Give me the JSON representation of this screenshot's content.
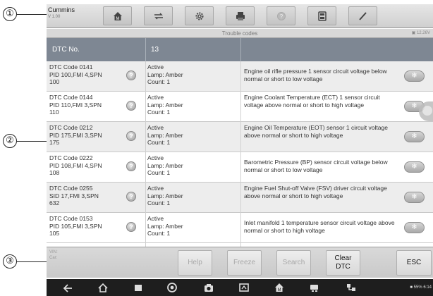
{
  "callouts": [
    "①",
    "②",
    "③"
  ],
  "brand": {
    "name": "Cummins",
    "version": "V 1.00"
  },
  "toolbar": {
    "icons": [
      "home-icon",
      "vehicle-swap-icon",
      "settings-gear-icon",
      "print-icon",
      "help-icon",
      "save-icon",
      "pen-icon"
    ]
  },
  "subbar": {
    "title": "Trouble codes",
    "battery": "12.26V"
  },
  "table": {
    "headers": [
      "DTC No.",
      "13",
      ""
    ],
    "rows": [
      {
        "dtc": [
          "DTC Code 0141",
          "PID 100,FMI 4,SPN",
          "100"
        ],
        "status": [
          "Active",
          "Lamp: Amber",
          "Count: 1"
        ],
        "desc": "Engine oil rifle pressure 1 sensor circuit voltage below normal or short to low voltage"
      },
      {
        "dtc": [
          "DTC Code 0144",
          "PID 110,FMI 3,SPN",
          "110"
        ],
        "status": [
          "Active",
          "Lamp: Amber",
          "Count: 1"
        ],
        "desc": "Engine Coolant Temperature (ECT) 1 sensor circuit voltage above normal or short to high voltage"
      },
      {
        "dtc": [
          "DTC Code 0212",
          "PID 175,FMI 3,SPN",
          "175"
        ],
        "status": [
          "Active",
          "Lamp: Amber",
          "Count: 1"
        ],
        "desc": "Engine Oil Temperature (EOT) sensor 1 circuit voltage above normal or short to high voltage"
      },
      {
        "dtc": [
          "DTC Code 0222",
          "PID 108,FMI 4,SPN",
          "108"
        ],
        "status": [
          "Active",
          "Lamp: Amber",
          "Count: 1"
        ],
        "desc": "Barometric Pressure (BP) sensor circuit voltage below normal or short to low voltage"
      },
      {
        "dtc": [
          "DTC Code 0255",
          "SID 17,FMI 3,SPN",
          "632"
        ],
        "status": [
          "Active",
          "Lamp: Amber",
          "Count: 1"
        ],
        "desc": "Engine Fuel Shut-off Valve (FSV) driver circuit voltage above normal or short to high voltage"
      },
      {
        "dtc": [
          "DTC Code 0153",
          "PID 105,FMI 3,SPN",
          "105"
        ],
        "status": [
          "Active",
          "Lamp: Amber",
          "Count: 1"
        ],
        "desc": "Inlet manifold 1 temperature sensor circuit voltage above normal or short to high voltage"
      }
    ]
  },
  "actionbar": {
    "vin_label": "VIN:",
    "car_label": "Car:",
    "buttons": {
      "help": "Help",
      "freeze": "Freeze",
      "search": "Search",
      "clear": "Clear DTC",
      "esc": "ESC"
    }
  },
  "navbar": {
    "icons": [
      "back-icon",
      "home-nav-icon",
      "recent-apps-icon",
      "browser-icon",
      "camera-icon",
      "screen-cast-icon",
      "autel-home-icon",
      "vci-icon",
      "network-icon"
    ],
    "status": "55% 6:14"
  },
  "colors": {
    "header": "#7e8793",
    "row_alt": "#ededed",
    "toolbar": "#d4d4d4",
    "navbar": "#1e1e1e"
  }
}
